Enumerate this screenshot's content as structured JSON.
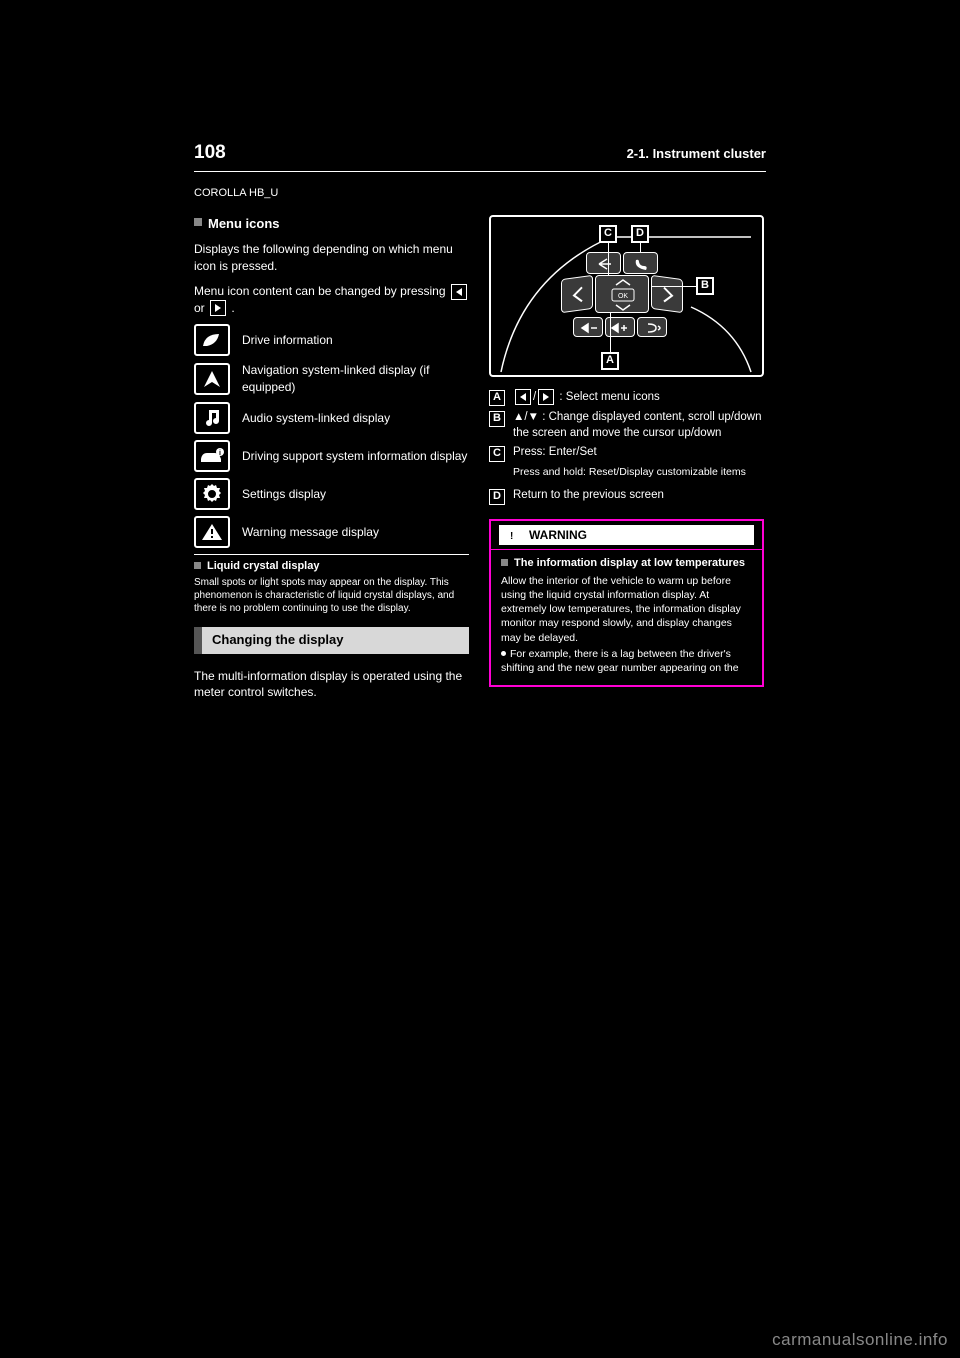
{
  "page_number": "108",
  "section_path": "2-1. Instrument cluster",
  "chapter_label": "COROLLA HB_U",
  "left": {
    "menu_icons_title": "Menu icons",
    "menu_intro_a": "Displays the following depending on which menu icon is pressed.",
    "menu_intro_b": "Menu icon content can be changed by pressing ",
    "menu_intro_c": " or ",
    "menu_intro_d": ".",
    "rows": [
      {
        "icon": "leaf",
        "label": "Drive information"
      },
      {
        "icon": "nav",
        "label": "Navigation system-linked display (if equipped)"
      },
      {
        "icon": "music",
        "label": "Audio system-linked display"
      },
      {
        "icon": "carinfo",
        "label": "Driving support system information display"
      },
      {
        "icon": "gear",
        "label": "Settings display"
      },
      {
        "icon": "warn",
        "label": "Warning message display"
      }
    ],
    "liq_title": "Liquid crystal display",
    "liq_text": "Small spots or light spots may appear on the display. This phenomenon is characteristic of liquid crystal displays, and there is no problem continuing to use the display.",
    "changing_label": "Changing the display",
    "changing_text": "The multi-information display is operated using the meter control switches."
  },
  "right": {
    "callouts": {
      "A": {
        "label": "A",
        "text": ": Select menu icons"
      },
      "B": {
        "label": "B",
        "text": "/",
        "text2": ": Change displayed content, scroll up/down the screen and move the cursor up/down"
      },
      "C": {
        "label": "C",
        "text": "Press: Enter/Set",
        "sub": "Press and hold: Reset/Display customizable items"
      },
      "D": {
        "label": "D",
        "text": "Return to the previous screen"
      }
    },
    "legend_b_symbols": {
      "up": "▲",
      "down": "▼"
    },
    "warning": {
      "title": "WARNING",
      "sub": "The information display at low temperatures",
      "text": "Allow the interior of the vehicle to warm up before using the liquid crystal information display. At extremely low temperatures, the information display monitor may respond slowly, and display changes may be delayed.",
      "text2": "For example, there is a lag between the driver's shifting and the new gear number appearing on the"
    }
  },
  "watermark": "carmanualsonline.info"
}
